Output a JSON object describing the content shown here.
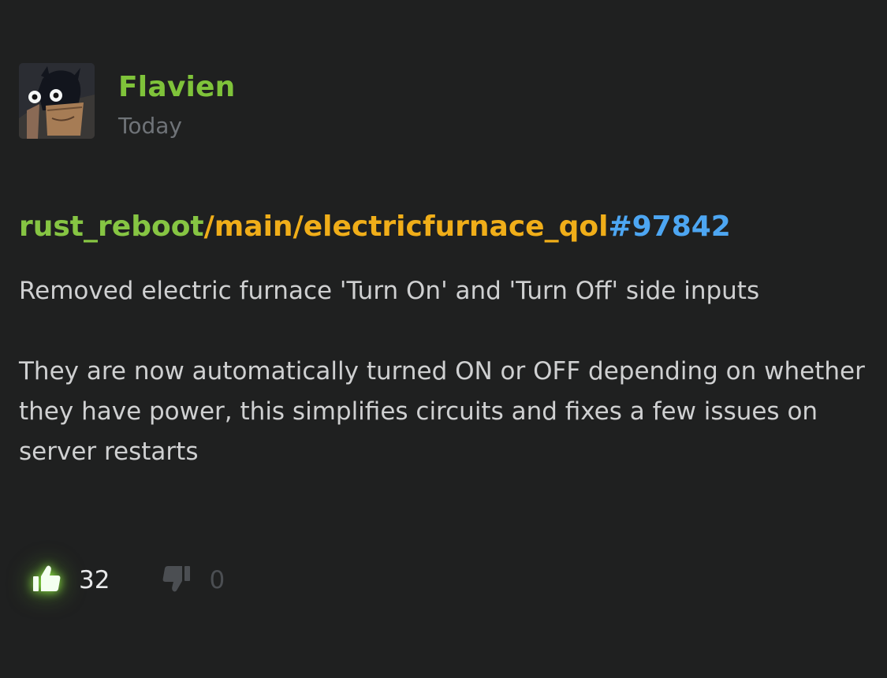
{
  "author": {
    "name": "Flavien",
    "time": "Today",
    "name_color": "#7fc33a",
    "avatar_icon": "masked-character-avatar"
  },
  "commit": {
    "repo": "rust_reboot",
    "branch": "/main/electricfurnace_qol",
    "id": "#97842",
    "colors": {
      "repo": "#86c543",
      "branch": "#f0ae19",
      "id": "#4da6f2"
    }
  },
  "message": {
    "paragraphs": [
      "Removed electric furnace 'Turn On' and 'Turn Off' side inputs",
      "They are now automatically turned ON or OFF depending on whether they have power, this simplifies circuits and fixes a few issues on server restarts"
    ]
  },
  "votes": {
    "up_count": "32",
    "down_count": "0",
    "up_icon": "thumbs-up-icon",
    "down_icon": "thumbs-down-icon",
    "up_color": "#e8e9ea",
    "down_color": "#4b4e52"
  }
}
